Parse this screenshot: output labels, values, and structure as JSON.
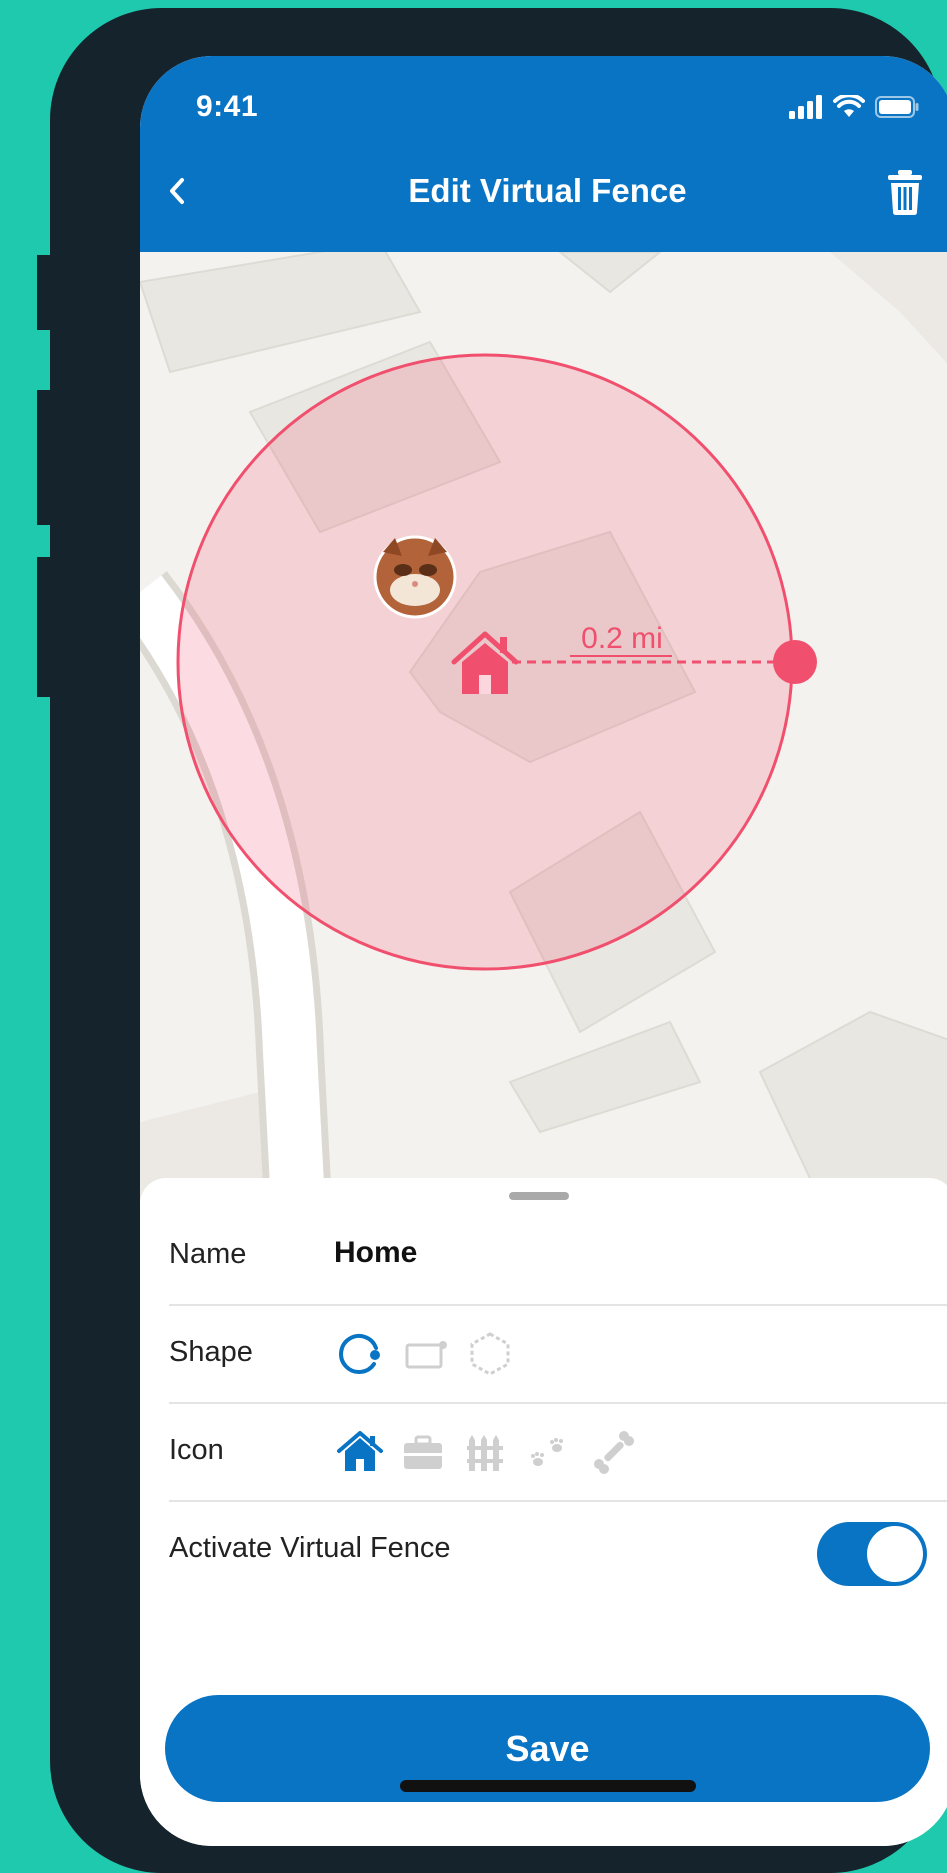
{
  "status_bar": {
    "time": "9:41",
    "icons": [
      "signal-icon",
      "wifi-icon",
      "battery-icon"
    ]
  },
  "header": {
    "title": "Edit Virtual Fence",
    "back_icon": "chevron-left-icon",
    "delete_icon": "trash-icon"
  },
  "map": {
    "radius_label": "0.2 mi",
    "fence_shape": "circle",
    "center_icon": "home-icon",
    "pet_avatar": "cat-avatar",
    "fence_color": "#f0506e"
  },
  "sheet": {
    "name_label": "Name",
    "name_value": "Home",
    "shape_label": "Shape",
    "shape_options": [
      "circle",
      "rectangle",
      "polygon"
    ],
    "shape_selected": "circle",
    "icon_label": "Icon",
    "icon_options": [
      "home-icon",
      "briefcase-icon",
      "fence-icon",
      "paw-icon",
      "bone-icon"
    ],
    "icon_selected": "home-icon",
    "activate_label": "Activate Virtual Fence",
    "activate_on": true,
    "save_label": "Save"
  },
  "colors": {
    "primary": "#0a74c4",
    "background": "#1ec9ad",
    "frame": "#15232c",
    "fence": "#f0506e",
    "inactive_icon": "#cfcfcf"
  }
}
